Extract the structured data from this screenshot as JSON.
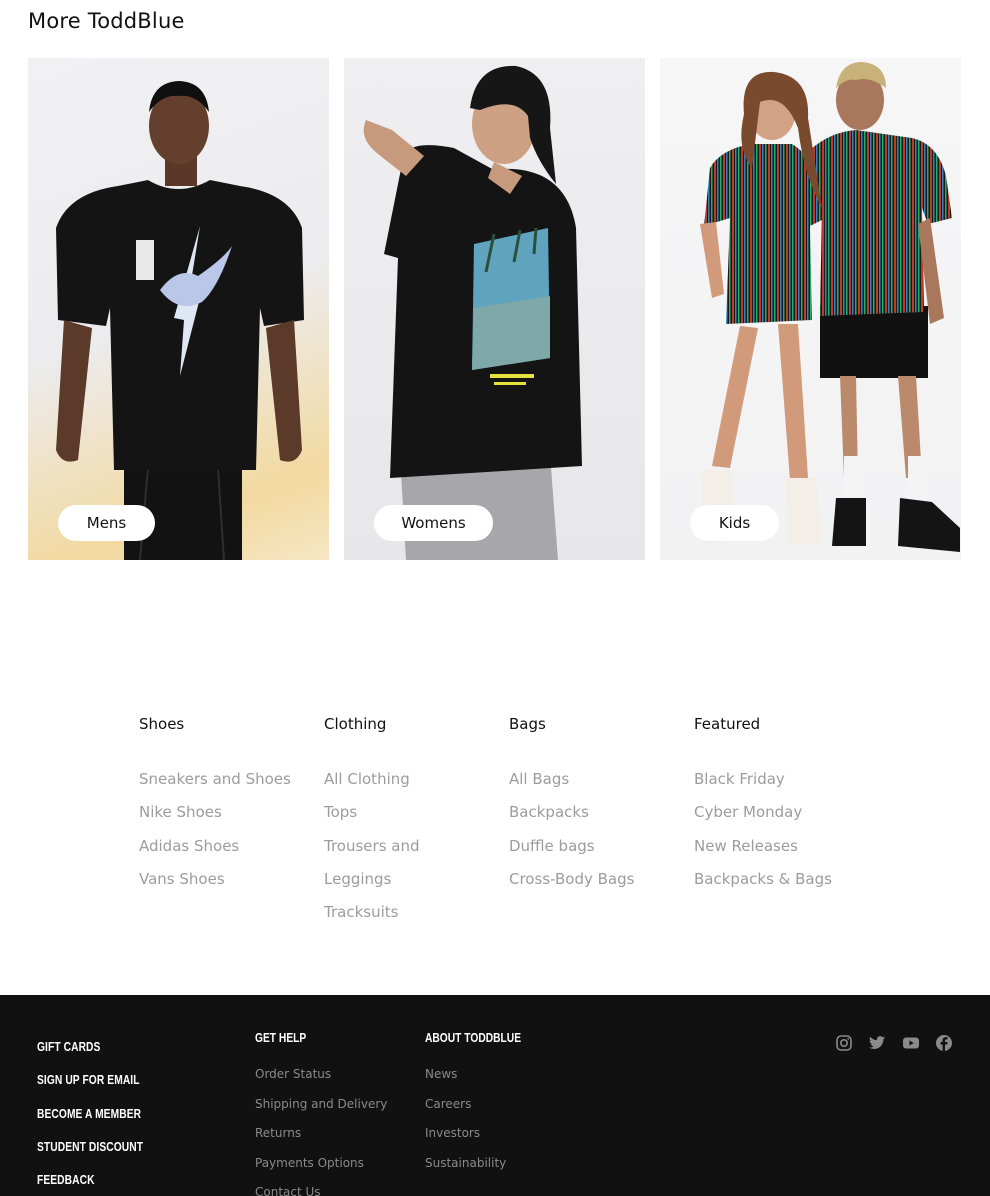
{
  "section": {
    "title": "More ToddBlue"
  },
  "cards": [
    {
      "label": "Mens"
    },
    {
      "label": "Womens"
    },
    {
      "label": "Kids"
    }
  ],
  "link_columns": [
    {
      "heading": "Shoes",
      "items": [
        "Sneakers and Shoes",
        "Nike Shoes",
        "Adidas Shoes",
        "Vans Shoes"
      ]
    },
    {
      "heading": "Clothing",
      "items": [
        "All Clothing",
        "Tops",
        "Trousers and",
        "Leggings",
        "Tracksuits"
      ]
    },
    {
      "heading": "Bags",
      "items": [
        "All Bags",
        "Backpacks",
        "Duffle bags",
        "Cross-Body Bags"
      ]
    },
    {
      "heading": "Featured",
      "items": [
        "Black Friday",
        "Cyber Monday",
        "New Releases",
        "Backpacks & Bags"
      ]
    }
  ],
  "footer": {
    "promo": [
      "Gift Cards",
      "Sign Up For Email",
      "Become A Member",
      "Student Discount",
      "Feedback"
    ],
    "help": {
      "heading": "Get Help",
      "items": [
        "Order Status",
        "Shipping and Delivery",
        "Returns",
        "Payments Options",
        "Contact Us"
      ]
    },
    "about": {
      "heading": "About ToddBlue",
      "items": [
        "News",
        "Careers",
        "Investors",
        "Sustainability"
      ]
    },
    "social": [
      "instagram-icon",
      "twitter-icon",
      "youtube-icon",
      "facebook-icon"
    ]
  },
  "colors": {
    "footer_bg": "#111111",
    "link_muted": "#9c9c9c",
    "footer_link": "#8a8a8a"
  }
}
